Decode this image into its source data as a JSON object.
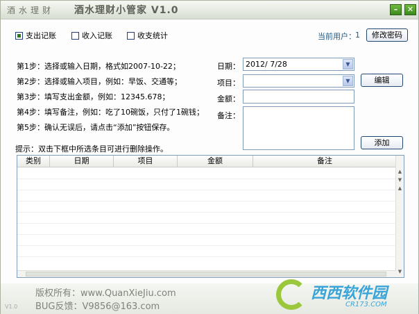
{
  "window": {
    "app_tag": "酒水理财",
    "title": "酒水理财小管家 V1.0",
    "min_glyph": "–",
    "close_glyph": "✕"
  },
  "modes": [
    {
      "label": "支出记账",
      "checked": true
    },
    {
      "label": "收入记账",
      "checked": false
    },
    {
      "label": "收支统计",
      "checked": false
    }
  ],
  "user": {
    "label": "当前用户：",
    "value": "1",
    "change_password": "修改密码"
  },
  "steps": [
    "第1步：选择或输入日期，格式如2007-10-22；",
    "第2步：选择或输入项目，例如：早饭、交通等；",
    "第3步：填写支出金额，例如：12345.678；",
    "第4步：填写备注，例如：吃了10碗饭，只付了1碗钱；",
    "第5步：确认无误后，请点击“添加”按钮保存。"
  ],
  "form": {
    "date_label": "日期：",
    "date_value": "2012/ 7/28",
    "item_label": "项目：",
    "item_value": "",
    "amount_label": "金额：",
    "amount_value": "",
    "note_label": "备注：",
    "note_value": "",
    "edit_button": "编辑",
    "add_button": "添加"
  },
  "hint": "提示：双击下框中所选条目可进行删除操作。",
  "table": {
    "columns": [
      "类别",
      "日期",
      "项目",
      "金额",
      "备注"
    ],
    "rows": []
  },
  "footer": {
    "copyright": "版权所有：www.QuanXieJiu.com",
    "feedback": "BUG反馈：V9856@163.com",
    "version": "V1.0"
  },
  "watermark": {
    "name": "西西软件园",
    "url": "CR173.COM"
  },
  "colors": {
    "accent_green": "#3b8a1c",
    "user_text": "#1c5a86",
    "border_blue": "#7f9db9"
  }
}
